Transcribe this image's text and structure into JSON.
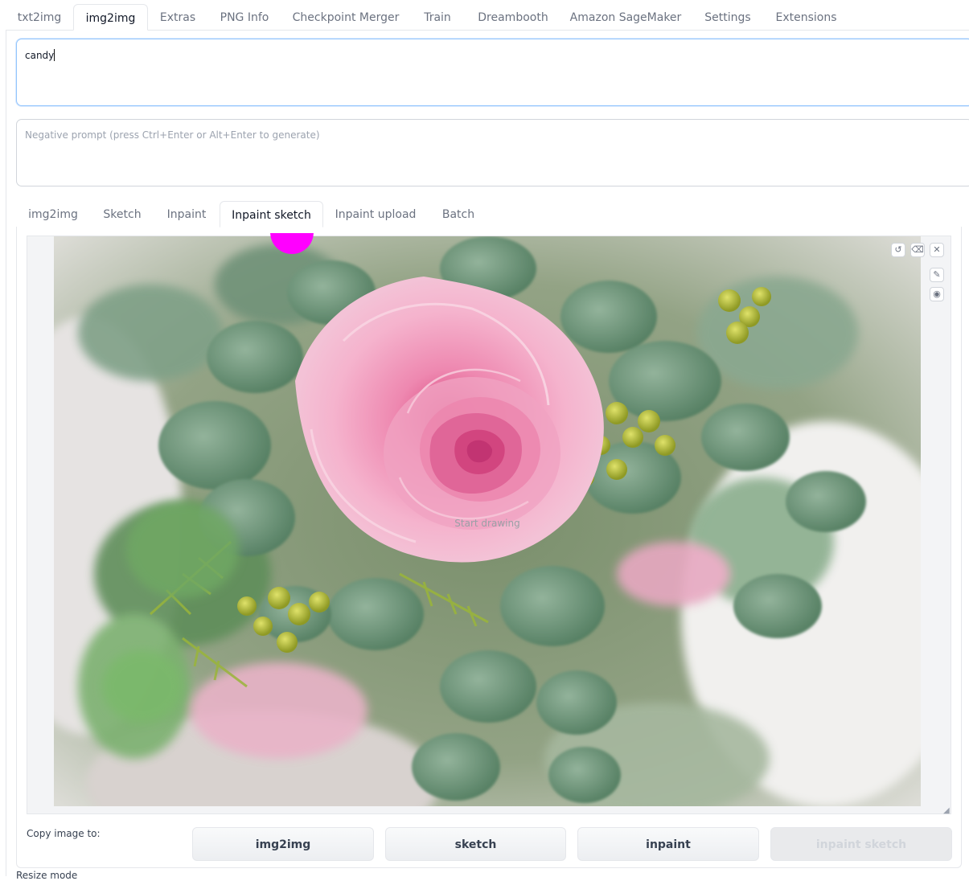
{
  "top_tabs": [
    "txt2img",
    "img2img",
    "Extras",
    "PNG Info",
    "Checkpoint Merger",
    "Train",
    "Dreambooth",
    "Amazon SageMaker",
    "Settings",
    "Extensions"
  ],
  "active_top_tab": "img2img",
  "prompt": {
    "value": "candy"
  },
  "negative_prompt": {
    "placeholder": "Negative prompt (press Ctrl+Enter or Alt+Enter to generate)"
  },
  "sub_tabs": [
    "img2img",
    "Sketch",
    "Inpaint",
    "Inpaint sketch",
    "Inpaint upload",
    "Batch"
  ],
  "active_sub_tab": "Inpaint sketch",
  "canvas": {
    "hint": "Start drawing",
    "brush_color": "#ff00ff"
  },
  "copy": {
    "label": "Copy image to:",
    "buttons": [
      "img2img",
      "sketch",
      "inpaint",
      "inpaint sketch"
    ]
  },
  "bottom_text": "Resize mode"
}
